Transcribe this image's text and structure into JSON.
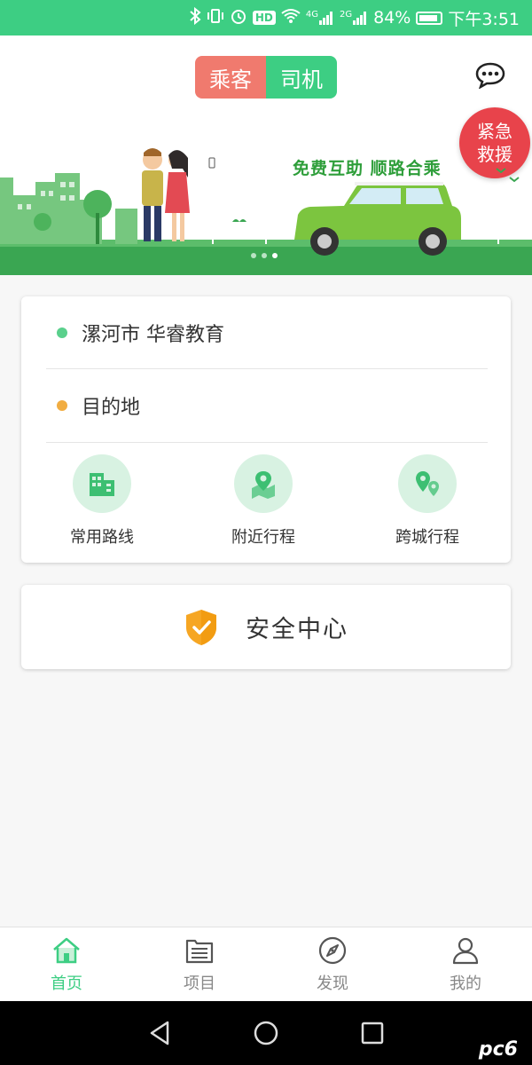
{
  "status_bar": {
    "battery": "84%",
    "time": "下午3:51",
    "icons": [
      "bluetooth-icon",
      "vibrate-icon",
      "alarm-icon",
      "hd-icon",
      "wifi-icon",
      "signal-4g-icon",
      "signal-2g-icon",
      "battery-icon"
    ],
    "hd": "HD",
    "net1": "4G",
    "net2": "2G"
  },
  "header": {
    "role_tabs": [
      {
        "label": "乘客",
        "active": true
      },
      {
        "label": "司机",
        "active": false
      }
    ],
    "chat_icon": "chat-bubble-icon",
    "sos_line1": "紧急",
    "sos_line2": "救援"
  },
  "banner": {
    "slogan": "免费互助  顺路合乘",
    "slide_count": 3,
    "active_slide": 2
  },
  "route_card": {
    "origin": "漯河市 华睿教育",
    "destination": "目的地",
    "shortcuts": [
      {
        "label": "常用路线",
        "icon": "building-icon"
      },
      {
        "label": "附近行程",
        "icon": "map-pin-icon"
      },
      {
        "label": "跨城行程",
        "icon": "multi-pin-icon"
      }
    ]
  },
  "safety_card": {
    "label": "安全中心",
    "icon": "shield-check-icon"
  },
  "tab_bar": {
    "tabs": [
      {
        "label": "首页",
        "icon": "home-icon",
        "active": true
      },
      {
        "label": "项目",
        "icon": "list-folder-icon",
        "active": false
      },
      {
        "label": "发现",
        "icon": "compass-icon",
        "active": false
      },
      {
        "label": "我的",
        "icon": "person-icon",
        "active": false
      }
    ]
  },
  "colors": {
    "accent": "#3dce83",
    "passenger": "#f07a6e",
    "sos": "#e8434b",
    "origin_dot": "#5ad08c",
    "destination_dot": "#f1ad42"
  },
  "watermark": "pc6"
}
